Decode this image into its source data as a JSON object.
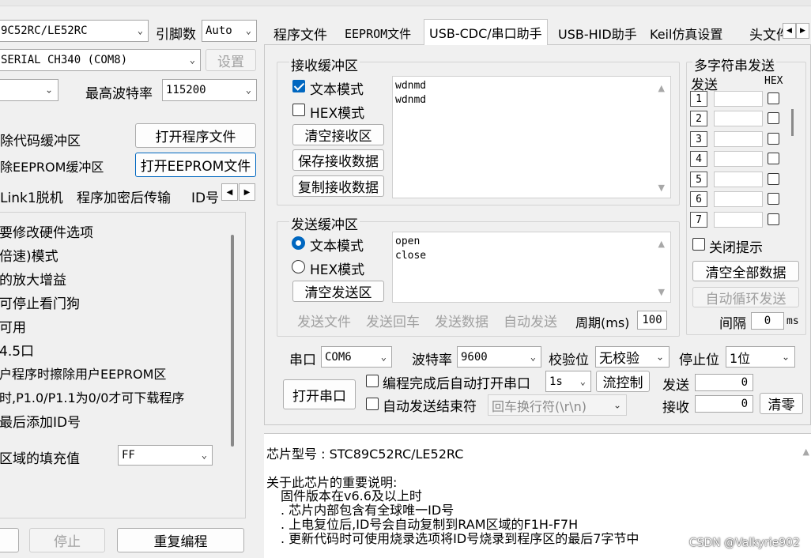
{
  "left": {
    "mcu_combo": "9C52RC/LE52RC",
    "pin_label": "引脚数",
    "pin_value": "Auto",
    "port_combo": "SERIAL CH340 (COM8)",
    "settings_button": "设置",
    "max_baud_label": "最高波特率",
    "max_baud_value": "115200",
    "clear_code_label": "除代码缓冲区",
    "clear_eeprom_label": "除EEPROM缓冲区",
    "open_program_button": "打开程序文件",
    "open_eeprom_button": "打开EEPROM文件",
    "subtabs": [
      "Link1脱机",
      "程序加密后传输",
      "ID号"
    ],
    "options": [
      "要修改硬件选项",
      "倍速)模式",
      "的放大增益",
      "可停止看门狗",
      "可用",
      "4.5口",
      "户程序时擦除用户EEPROM区",
      "时,P1.0/P1.1为0/0才可下载程序",
      "最后添加ID号"
    ],
    "fill_label": "区域的填充值",
    "fill_value": "FF",
    "stop_button": "停止",
    "reprogram_button": "重复编程"
  },
  "tabs": [
    "程序文件",
    "EEPROM文件",
    "USB-CDC/串口助手",
    "USB-HID助手",
    "Keil仿真设置",
    "头文件"
  ],
  "receive": {
    "title": "接收缓冲区",
    "text_mode": "文本模式",
    "hex_mode": "HEX模式",
    "clear_button": "清空接收区",
    "save_button": "保存接收数据",
    "copy_button": "复制接收数据",
    "content": "wdnmd\nwdnmd"
  },
  "send": {
    "title": "发送缓冲区",
    "text_mode": "文本模式",
    "hex_mode": "HEX模式",
    "clear_button": "清空发送区",
    "content": "open\nclose",
    "send_file": "发送文件",
    "send_enter": "发送回车",
    "send_data": "发送数据",
    "auto_send": "自动发送",
    "period_label": "周期(ms)",
    "period_value": "100"
  },
  "multi": {
    "title": "多字符串发送",
    "send_header": "发送",
    "hex_header": "HEX",
    "rows": [
      "1",
      "2",
      "3",
      "4",
      "5",
      "6",
      "7"
    ],
    "close_tip": "关闭提示",
    "clear_all": "清空全部数据",
    "auto_loop": "自动循环发送",
    "interval_label": "间隔",
    "interval_value": "0",
    "interval_unit": "ms"
  },
  "serial": {
    "port_label": "串口",
    "port_value": "COM6",
    "baud_label": "波特率",
    "baud_value": "9600",
    "parity_label": "校验位",
    "parity_value": "无校验",
    "stop_label": "停止位",
    "stop_value": "1位",
    "open_button": "打开串口",
    "auto_open": "编程完成后自动打开串口",
    "auto_open_delay": "1s",
    "flow_button": "流控制",
    "auto_end": "自动发送结束符",
    "end_char": "回车换行符(\\r\\n)",
    "tx_label": "发送",
    "tx_value": "0",
    "rx_label": "接收",
    "rx_value": "0",
    "reset_button": "清零"
  },
  "info": {
    "chip_line": "芯片型号 : STC89C52RC/LE52RC",
    "note_title": "关于此芯片的重要说明:",
    "lines": [
      "固件版本在v6.6及以上时",
      ". 芯片内部包含有全球唯一ID号",
      ". 上电复位后,ID号会自动复制到RAM区域的F1H-F7H",
      ". 更新代码时可使用烧录选项将ID号烧录到程序区的最后7字节中"
    ],
    "watermark": "CSDN @Valkyrie902"
  },
  "colors": {
    "accent": "#0067c0",
    "window_bg": "#f0f0f0"
  }
}
